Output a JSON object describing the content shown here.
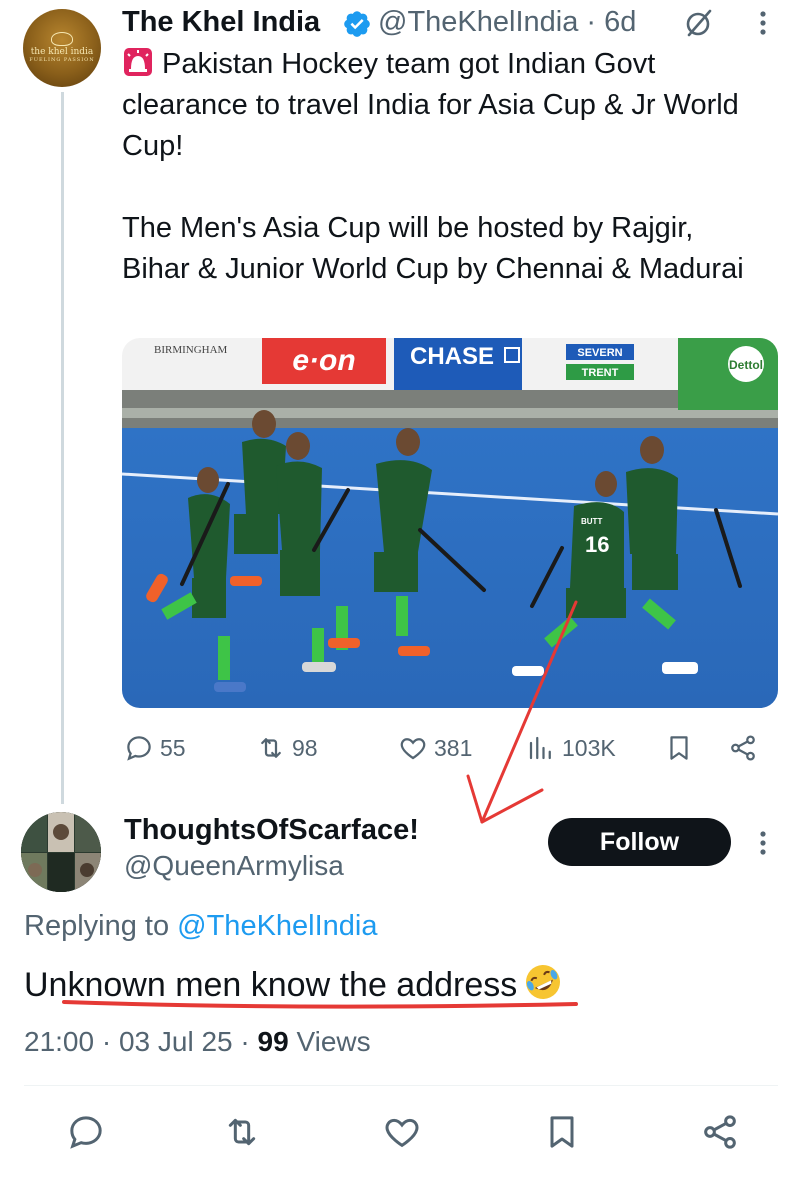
{
  "tweet": {
    "author_name": "The Khel India",
    "handle": "@TheKhelIndia",
    "time": "6d",
    "avatar_text_line1": "the khel india",
    "avatar_text_line2": "fueling passion",
    "text_line1": "Pakistan Hockey team got Indian Govt clearance to travel India for Asia Cup & Jr World Cup!",
    "text_line2": "The Men's Asia Cup will be hosted by Rajgir, Bihar & Junior World Cup by Chennai & Madurai",
    "emoji_icon": "police-siren-icon",
    "media": {
      "banner_birmingham": "BIRMINGHAM",
      "banner_eon": "e·on",
      "banner_chase": "CHASE",
      "banner_severn": "SEVERN",
      "banner_trent": "TRENT",
      "banner_dettol": "Dettol",
      "jersey_number": "16",
      "jersey_name": "BUTT"
    },
    "stats": {
      "replies": "55",
      "reposts": "98",
      "likes": "381",
      "views": "103K"
    }
  },
  "reply": {
    "author_name": "ThoughtsOfScarface!",
    "handle": "@QueenArmylisa",
    "follow_label": "Follow",
    "replying_prefix": "Replying to",
    "replying_to": "@TheKhelIndia",
    "text": "Unknown men know the address",
    "emoji_icon": "rofl-emoji-icon",
    "time": "21:00",
    "date": "03 Jul 25",
    "views_count": "99",
    "views_label": "Views"
  },
  "colors": {
    "text_primary": "#0f1419",
    "text_secondary": "#536471",
    "link": "#1d9bf0",
    "verified": "#1d9bf0",
    "annotation_red": "#e53935",
    "follow_bg": "#0f1419"
  }
}
